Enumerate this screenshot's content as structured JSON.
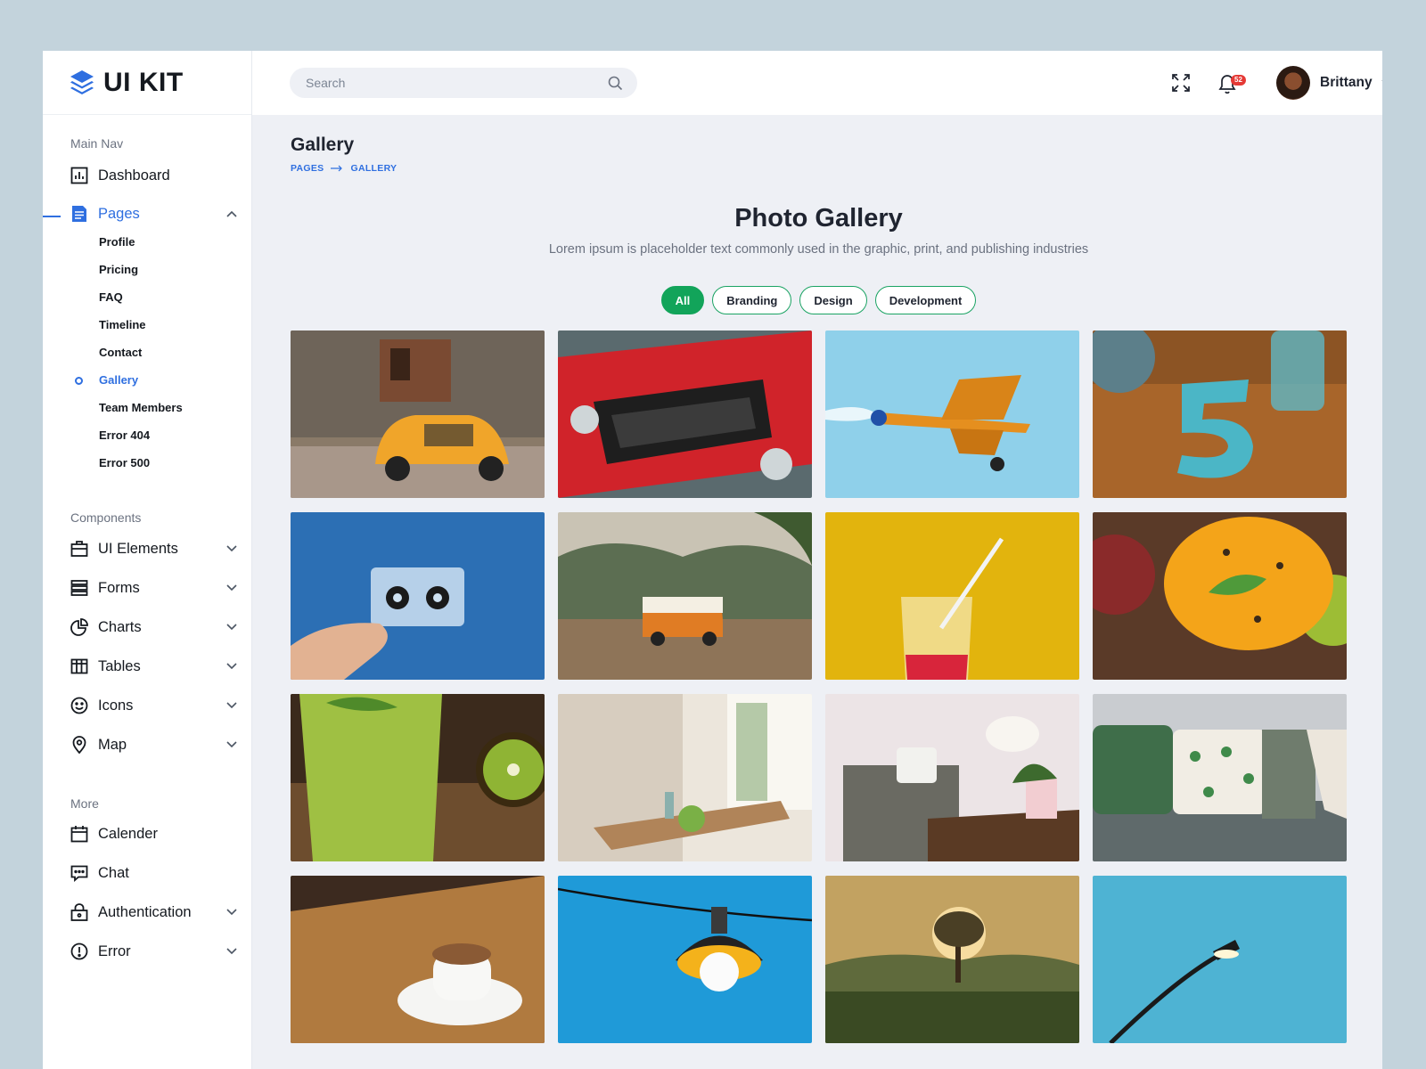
{
  "brand": {
    "name": "UI KIT",
    "accent": "#2f6fe0",
    "green": "#12a45a"
  },
  "sidebar": {
    "sections": {
      "main": "Main Nav",
      "components": "Components",
      "more": "More"
    },
    "main_items": [
      {
        "label": "Dashboard",
        "icon": "bar-chart-icon"
      },
      {
        "label": "Pages",
        "icon": "document-icon",
        "active": true
      }
    ],
    "pages_subitems": [
      "Profile",
      "Pricing",
      "FAQ",
      "Timeline",
      "Contact",
      "Gallery",
      "Team Members",
      "Error 404",
      "Error 500"
    ],
    "component_items": [
      {
        "label": "UI Elements",
        "icon": "briefcase-icon"
      },
      {
        "label": "Forms",
        "icon": "forms-icon"
      },
      {
        "label": "Charts",
        "icon": "pie-chart-icon"
      },
      {
        "label": "Tables",
        "icon": "table-icon"
      },
      {
        "label": "Icons",
        "icon": "smiley-icon"
      },
      {
        "label": "Map",
        "icon": "map-pin-icon"
      }
    ],
    "more_items": [
      {
        "label": "Calender",
        "icon": "calendar-icon"
      },
      {
        "label": "Chat",
        "icon": "chat-icon"
      },
      {
        "label": "Authentication",
        "icon": "lock-icon"
      },
      {
        "label": "Error",
        "icon": "alert-icon"
      }
    ]
  },
  "header": {
    "search_placeholder": "Search",
    "notifications_count": "52",
    "user_name": "Brittany"
  },
  "page": {
    "title": "Gallery",
    "breadcrumb": [
      "PAGES",
      "GALLERY"
    ],
    "gallery_title": "Photo Gallery",
    "gallery_subtitle": "Lorem ipsum is placeholder text commonly used in the graphic, print, and publishing industries",
    "filters": [
      "All",
      "Branding",
      "Design",
      "Development"
    ],
    "active_filter": "All"
  }
}
